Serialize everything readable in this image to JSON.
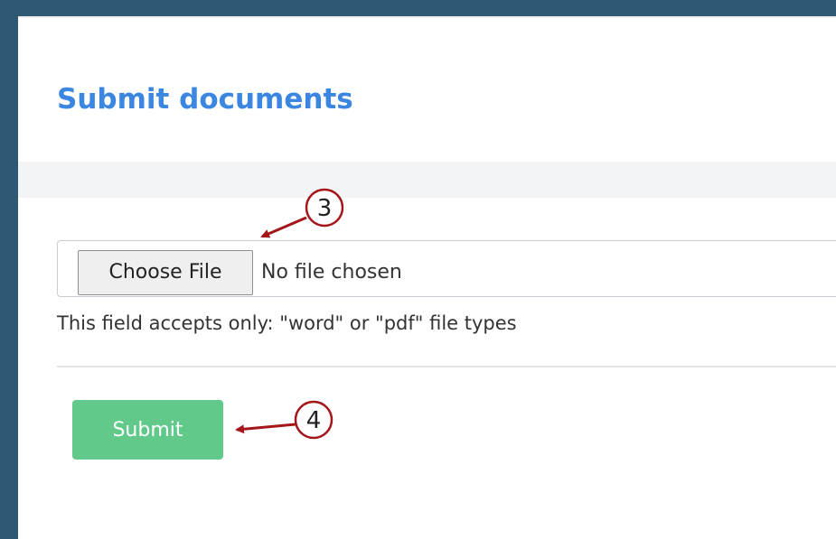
{
  "page": {
    "title": "Submit documents"
  },
  "upload": {
    "choose_button_label": "Choose File",
    "status_text": "No file chosen",
    "help_text": "This field accepts only: \"word\" or \"pdf\" file types"
  },
  "form": {
    "submit_label": "Submit"
  },
  "annotations": [
    {
      "number": "3",
      "target": "choose-file-button"
    },
    {
      "number": "4",
      "target": "submit-button"
    }
  ],
  "colors": {
    "frame": "#2f5873",
    "title": "#3a86e0",
    "submit_bg": "#61c98a",
    "annotation": "#a4161a"
  }
}
